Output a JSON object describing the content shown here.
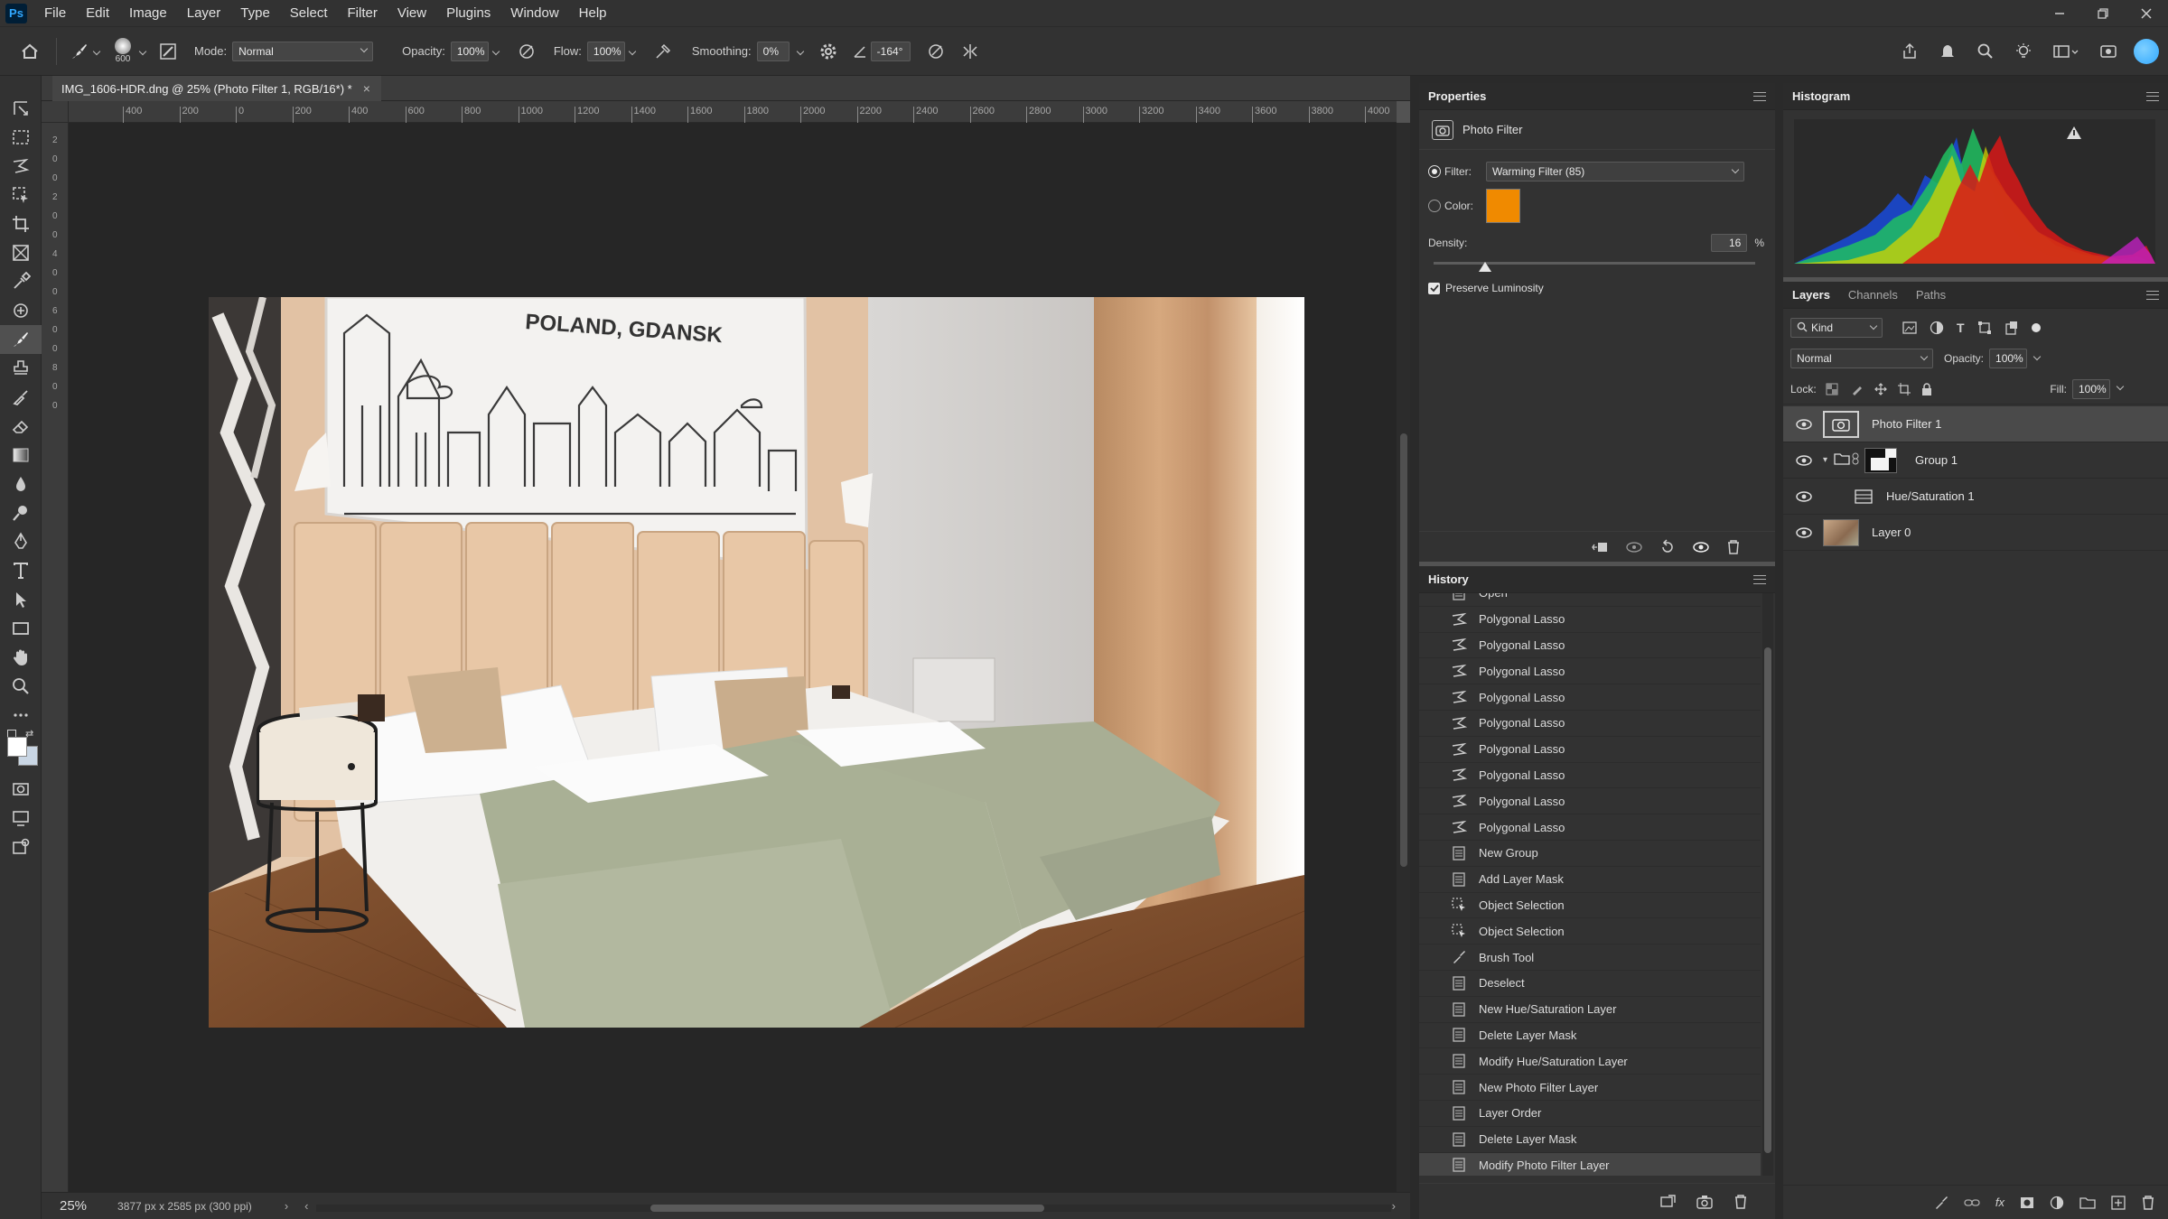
{
  "menubar": {
    "logo": "Ps",
    "items": [
      "File",
      "Edit",
      "Image",
      "Layer",
      "Type",
      "Select",
      "Filter",
      "View",
      "Plugins",
      "Window",
      "Help"
    ]
  },
  "options": {
    "brush_size": "600",
    "mode_label": "Mode:",
    "mode_value": "Normal",
    "opacity_label": "Opacity:",
    "opacity_value": "100%",
    "flow_label": "Flow:",
    "flow_value": "100%",
    "smoothing_label": "Smoothing:",
    "smoothing_value": "0%",
    "angle_value": "-164°"
  },
  "document": {
    "tab_title": "IMG_1606-HDR.dng @ 25% (Photo Filter 1, RGB/16*) *",
    "ruler_h": [
      "400",
      "200",
      "0",
      "200",
      "400",
      "600",
      "800",
      "1000",
      "1200",
      "1400",
      "1600",
      "1800",
      "2000",
      "2200",
      "2400",
      "2600",
      "2800",
      "3000",
      "3200",
      "3400",
      "3600",
      "3800",
      "4000"
    ],
    "ruler_v": [
      "2",
      "0",
      "0",
      "2",
      "0",
      "0",
      "4",
      "0",
      "0",
      "6",
      "0",
      "0",
      "8",
      "0",
      "0"
    ],
    "photo_caption": "POLAND, GDANSK"
  },
  "status": {
    "zoom": "25%",
    "doc_info": "3877 px x 2585 px (300 ppi)"
  },
  "properties": {
    "title": "Properties",
    "adjustment_name": "Photo Filter",
    "filter_label": "Filter:",
    "filter_value": "Warming Filter (85)",
    "color_label": "Color:",
    "color_swatch": "#f08a00",
    "density_label": "Density:",
    "density_value": "16",
    "density_unit": "%",
    "density_fraction": 0.16,
    "preserve_label": "Preserve Luminosity"
  },
  "history": {
    "title": "History",
    "items": [
      {
        "label": "Open",
        "icon": "document-icon"
      },
      {
        "label": "Polygonal Lasso",
        "icon": "polygonal-lasso-icon"
      },
      {
        "label": "Polygonal Lasso",
        "icon": "polygonal-lasso-icon"
      },
      {
        "label": "Polygonal Lasso",
        "icon": "polygonal-lasso-icon"
      },
      {
        "label": "Polygonal Lasso",
        "icon": "polygonal-lasso-icon"
      },
      {
        "label": "Polygonal Lasso",
        "icon": "polygonal-lasso-icon"
      },
      {
        "label": "Polygonal Lasso",
        "icon": "polygonal-lasso-icon"
      },
      {
        "label": "Polygonal Lasso",
        "icon": "polygonal-lasso-icon"
      },
      {
        "label": "Polygonal Lasso",
        "icon": "polygonal-lasso-icon"
      },
      {
        "label": "Polygonal Lasso",
        "icon": "polygonal-lasso-icon"
      },
      {
        "label": "New Group",
        "icon": "document-icon"
      },
      {
        "label": "Add Layer Mask",
        "icon": "document-icon"
      },
      {
        "label": "Object Selection",
        "icon": "object-selection-icon"
      },
      {
        "label": "Object Selection",
        "icon": "object-selection-icon"
      },
      {
        "label": "Brush Tool",
        "icon": "brush-icon"
      },
      {
        "label": "Deselect",
        "icon": "document-icon"
      },
      {
        "label": "New Hue/Saturation Layer",
        "icon": "document-icon"
      },
      {
        "label": "Delete Layer Mask",
        "icon": "document-icon"
      },
      {
        "label": "Modify Hue/Saturation Layer",
        "icon": "document-icon"
      },
      {
        "label": "New Photo Filter Layer",
        "icon": "document-icon"
      },
      {
        "label": "Layer Order",
        "icon": "document-icon"
      },
      {
        "label": "Delete Layer Mask",
        "icon": "document-icon"
      },
      {
        "label": "Modify Photo Filter Layer",
        "icon": "document-icon"
      }
    ]
  },
  "histogram": {
    "title": "Histogram"
  },
  "layers": {
    "tabs": [
      "Layers",
      "Channels",
      "Paths"
    ],
    "kind_label": "Kind",
    "blend_mode": "Normal",
    "opacity_label": "Opacity:",
    "opacity_value": "100%",
    "lock_label": "Lock:",
    "fill_label": "Fill:",
    "fill_value": "100%",
    "rows": [
      {
        "name": "Photo Filter 1"
      },
      {
        "name": "Group 1"
      },
      {
        "name": "Hue/Saturation 1"
      },
      {
        "name": "Layer 0"
      }
    ]
  },
  "colors": {
    "accent": "#31a8ff",
    "swatch": "#f08a00"
  }
}
